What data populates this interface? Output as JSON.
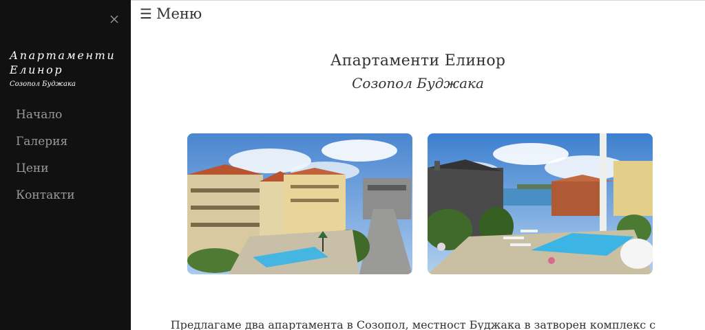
{
  "sidebar": {
    "brand_title": "Апартаменти Елинор",
    "brand_subtitle": "Созопол Буджака",
    "nav": [
      {
        "label": "Начало"
      },
      {
        "label": "Галерия"
      },
      {
        "label": "Цени"
      },
      {
        "label": "Контакти"
      }
    ],
    "close_icon": "close-icon",
    "background": "#111111"
  },
  "header": {
    "menu_glyph": "☰",
    "menu_label": "Меню"
  },
  "hero": {
    "title": "Апартаменти Елинор",
    "subtitle": "Созопол Буджака"
  },
  "gallery": [
    {
      "name": "complex-pool-photo"
    },
    {
      "name": "sea-view-pool-photo"
    }
  ],
  "intro": {
    "text": "Предлагаме два апартамента в Созопол, местност Буджака в затворен комплекс с"
  }
}
